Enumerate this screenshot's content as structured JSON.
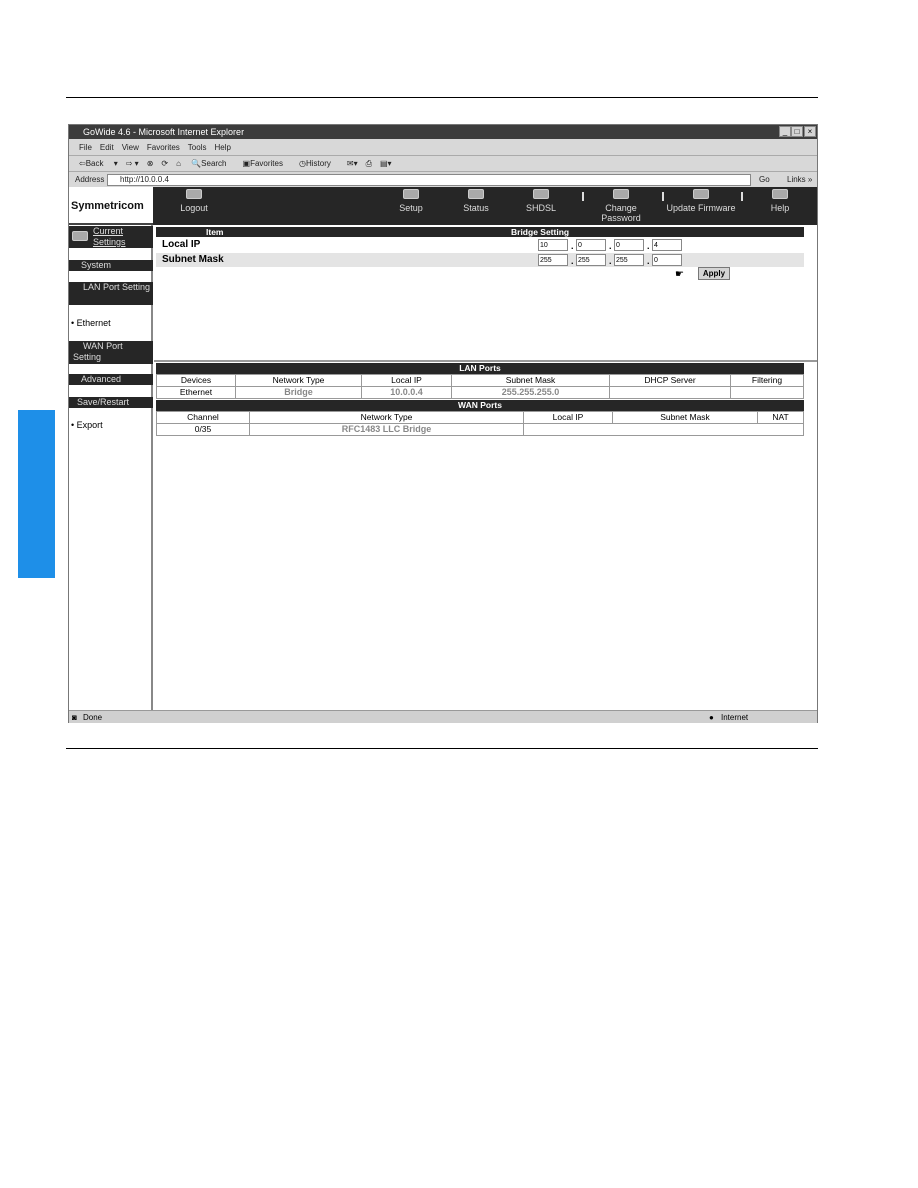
{
  "browser": {
    "title": "GoWide 4.6 - Microsoft Internet Explorer",
    "menu": [
      "File",
      "Edit",
      "View",
      "Favorites",
      "Tools",
      "Help"
    ],
    "toolbar": [
      "Back",
      "Search",
      "Favorites",
      "History"
    ],
    "address_label": "Address",
    "url": "http://10.0.0.4",
    "go": "Go",
    "links": "Links »",
    "status": "Done",
    "zone": "Internet"
  },
  "logo": "Symmetricom",
  "nav": [
    {
      "label": "Logout",
      "icon": "logout-icon"
    },
    {
      "label": "Setup",
      "icon": "setup-icon"
    },
    {
      "label": "Status",
      "icon": "status-icon"
    },
    {
      "label": "SHDSL",
      "icon": "shdsl-icon"
    },
    {
      "label": "Change Password",
      "icon": "password-icon"
    },
    {
      "label": "Update Firmware",
      "icon": "firmware-icon"
    },
    {
      "label": "Help",
      "icon": "help-icon"
    }
  ],
  "sidebar": {
    "current": "Current Settings",
    "system": "System",
    "lan": "LAN Port Setting",
    "ethernet": "Ethernet",
    "wan": "WAN Port Setting",
    "advanced": "Advanced",
    "save": "Save/Restart",
    "export": "Export"
  },
  "form": {
    "col_item": "Item",
    "col_setting": "Bridge Setting",
    "local_ip_label": "Local IP",
    "local_ip": [
      "10",
      "0",
      "0",
      "4"
    ],
    "mask_label": "Subnet Mask",
    "mask": [
      "255",
      "255",
      "255",
      "0"
    ],
    "apply": "Apply"
  },
  "lan": {
    "title": "LAN Ports",
    "headers": [
      "Devices",
      "Network Type",
      "Local IP",
      "Subnet Mask",
      "DHCP Server",
      "Filtering"
    ],
    "row": [
      "Ethernet",
      "Bridge",
      "10.0.0.4",
      "255.255.255.0",
      "",
      ""
    ]
  },
  "wan": {
    "title": "WAN Ports",
    "headers": [
      "Channel",
      "Network Type",
      "Local IP",
      "Subnet Mask",
      "NAT"
    ],
    "row": [
      "0/35",
      "RFC1483 LLC Bridge",
      "",
      "",
      ""
    ]
  },
  "colors": {
    "tab": "#1e8fe8",
    "nav": "#262626"
  }
}
